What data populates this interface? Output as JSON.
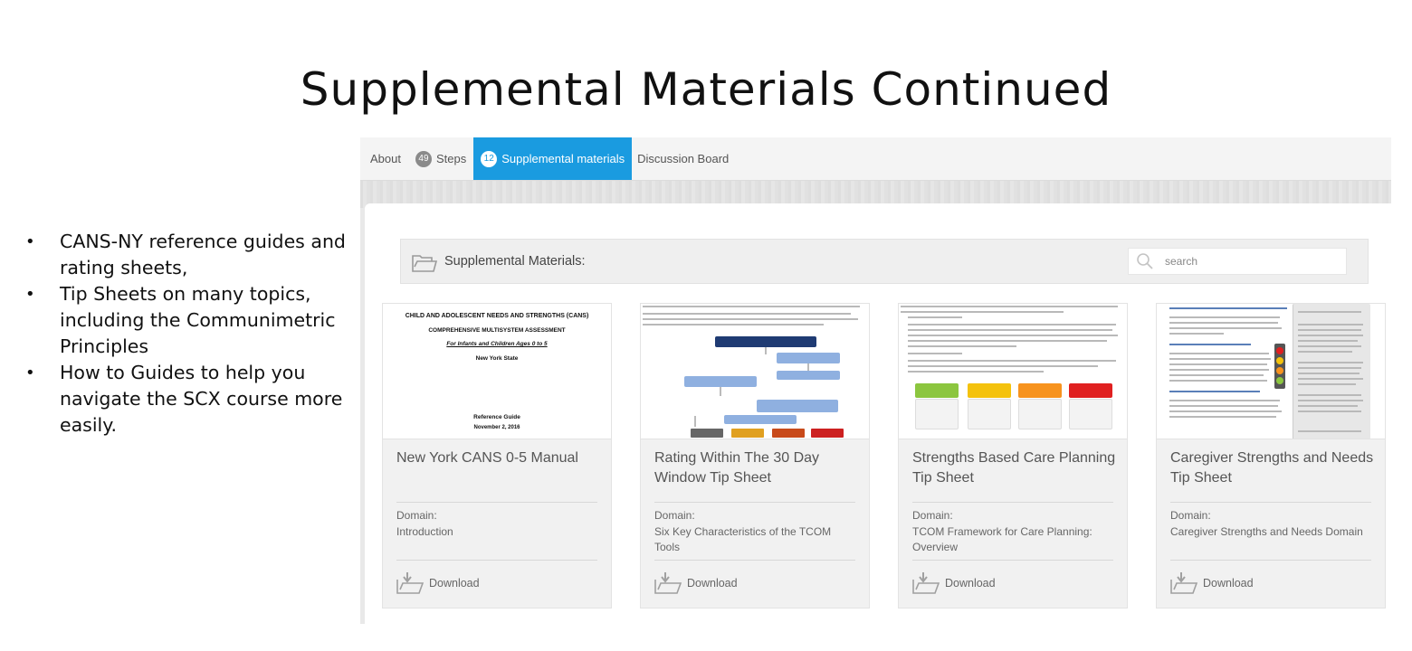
{
  "slide": {
    "title": "Supplemental Materials Continued",
    "bullets": [
      "CANS-NY reference guides and rating sheets,",
      "Tip Sheets on many topics, including the Communimetric Principles",
      "How to Guides to help you navigate the SCX course more easily."
    ]
  },
  "nav": {
    "tabs": [
      {
        "label": "About",
        "count": null
      },
      {
        "label": "Steps",
        "count": "49"
      },
      {
        "label": "Supplemental materials",
        "count": "12",
        "active": true
      },
      {
        "label": "Discussion Board",
        "count": null
      }
    ]
  },
  "materials": {
    "header": "Supplemental Materials:",
    "search_placeholder": "search",
    "domain_label": "Domain:",
    "download_label": "Download",
    "cards": [
      {
        "title": "New York CANS 0-5 Manual",
        "domain": "Introduction",
        "thumb": {
          "heading": "CHILD AND ADOLESCENT NEEDS AND STRENGTHS (CANS)",
          "subheading": "COMPREHENSIVE MULTISYSTEM ASSESSMENT",
          "ages": "For Infants and Children Ages 0 to 5",
          "state": "New York State",
          "guide": "Reference Guide",
          "date": "November 2, 2016"
        }
      },
      {
        "title": "Rating Within The 30 Day Window Tip Sheet",
        "domain": "Six Key Characteristics of the TCOM Tools"
      },
      {
        "title": "Strengths Based Care Planning Tip Sheet",
        "domain": "TCOM Framework for Care Planning: Overview"
      },
      {
        "title": "Caregiver Strengths and Needs Tip Sheet",
        "domain": "Caregiver Strengths and Needs Domain"
      }
    ]
  },
  "colors": {
    "active_tab": "#1a9be0",
    "card_bg": "#f1f1f1",
    "flow_blue": "#1f3b73",
    "flow_light": "#8fb0e0",
    "green": "#8cc63f",
    "yellow": "#f4c20d",
    "orange": "#f7931e",
    "red": "#e02020"
  },
  "icons": [
    "folder-icon",
    "search-icon",
    "download-icon"
  ]
}
